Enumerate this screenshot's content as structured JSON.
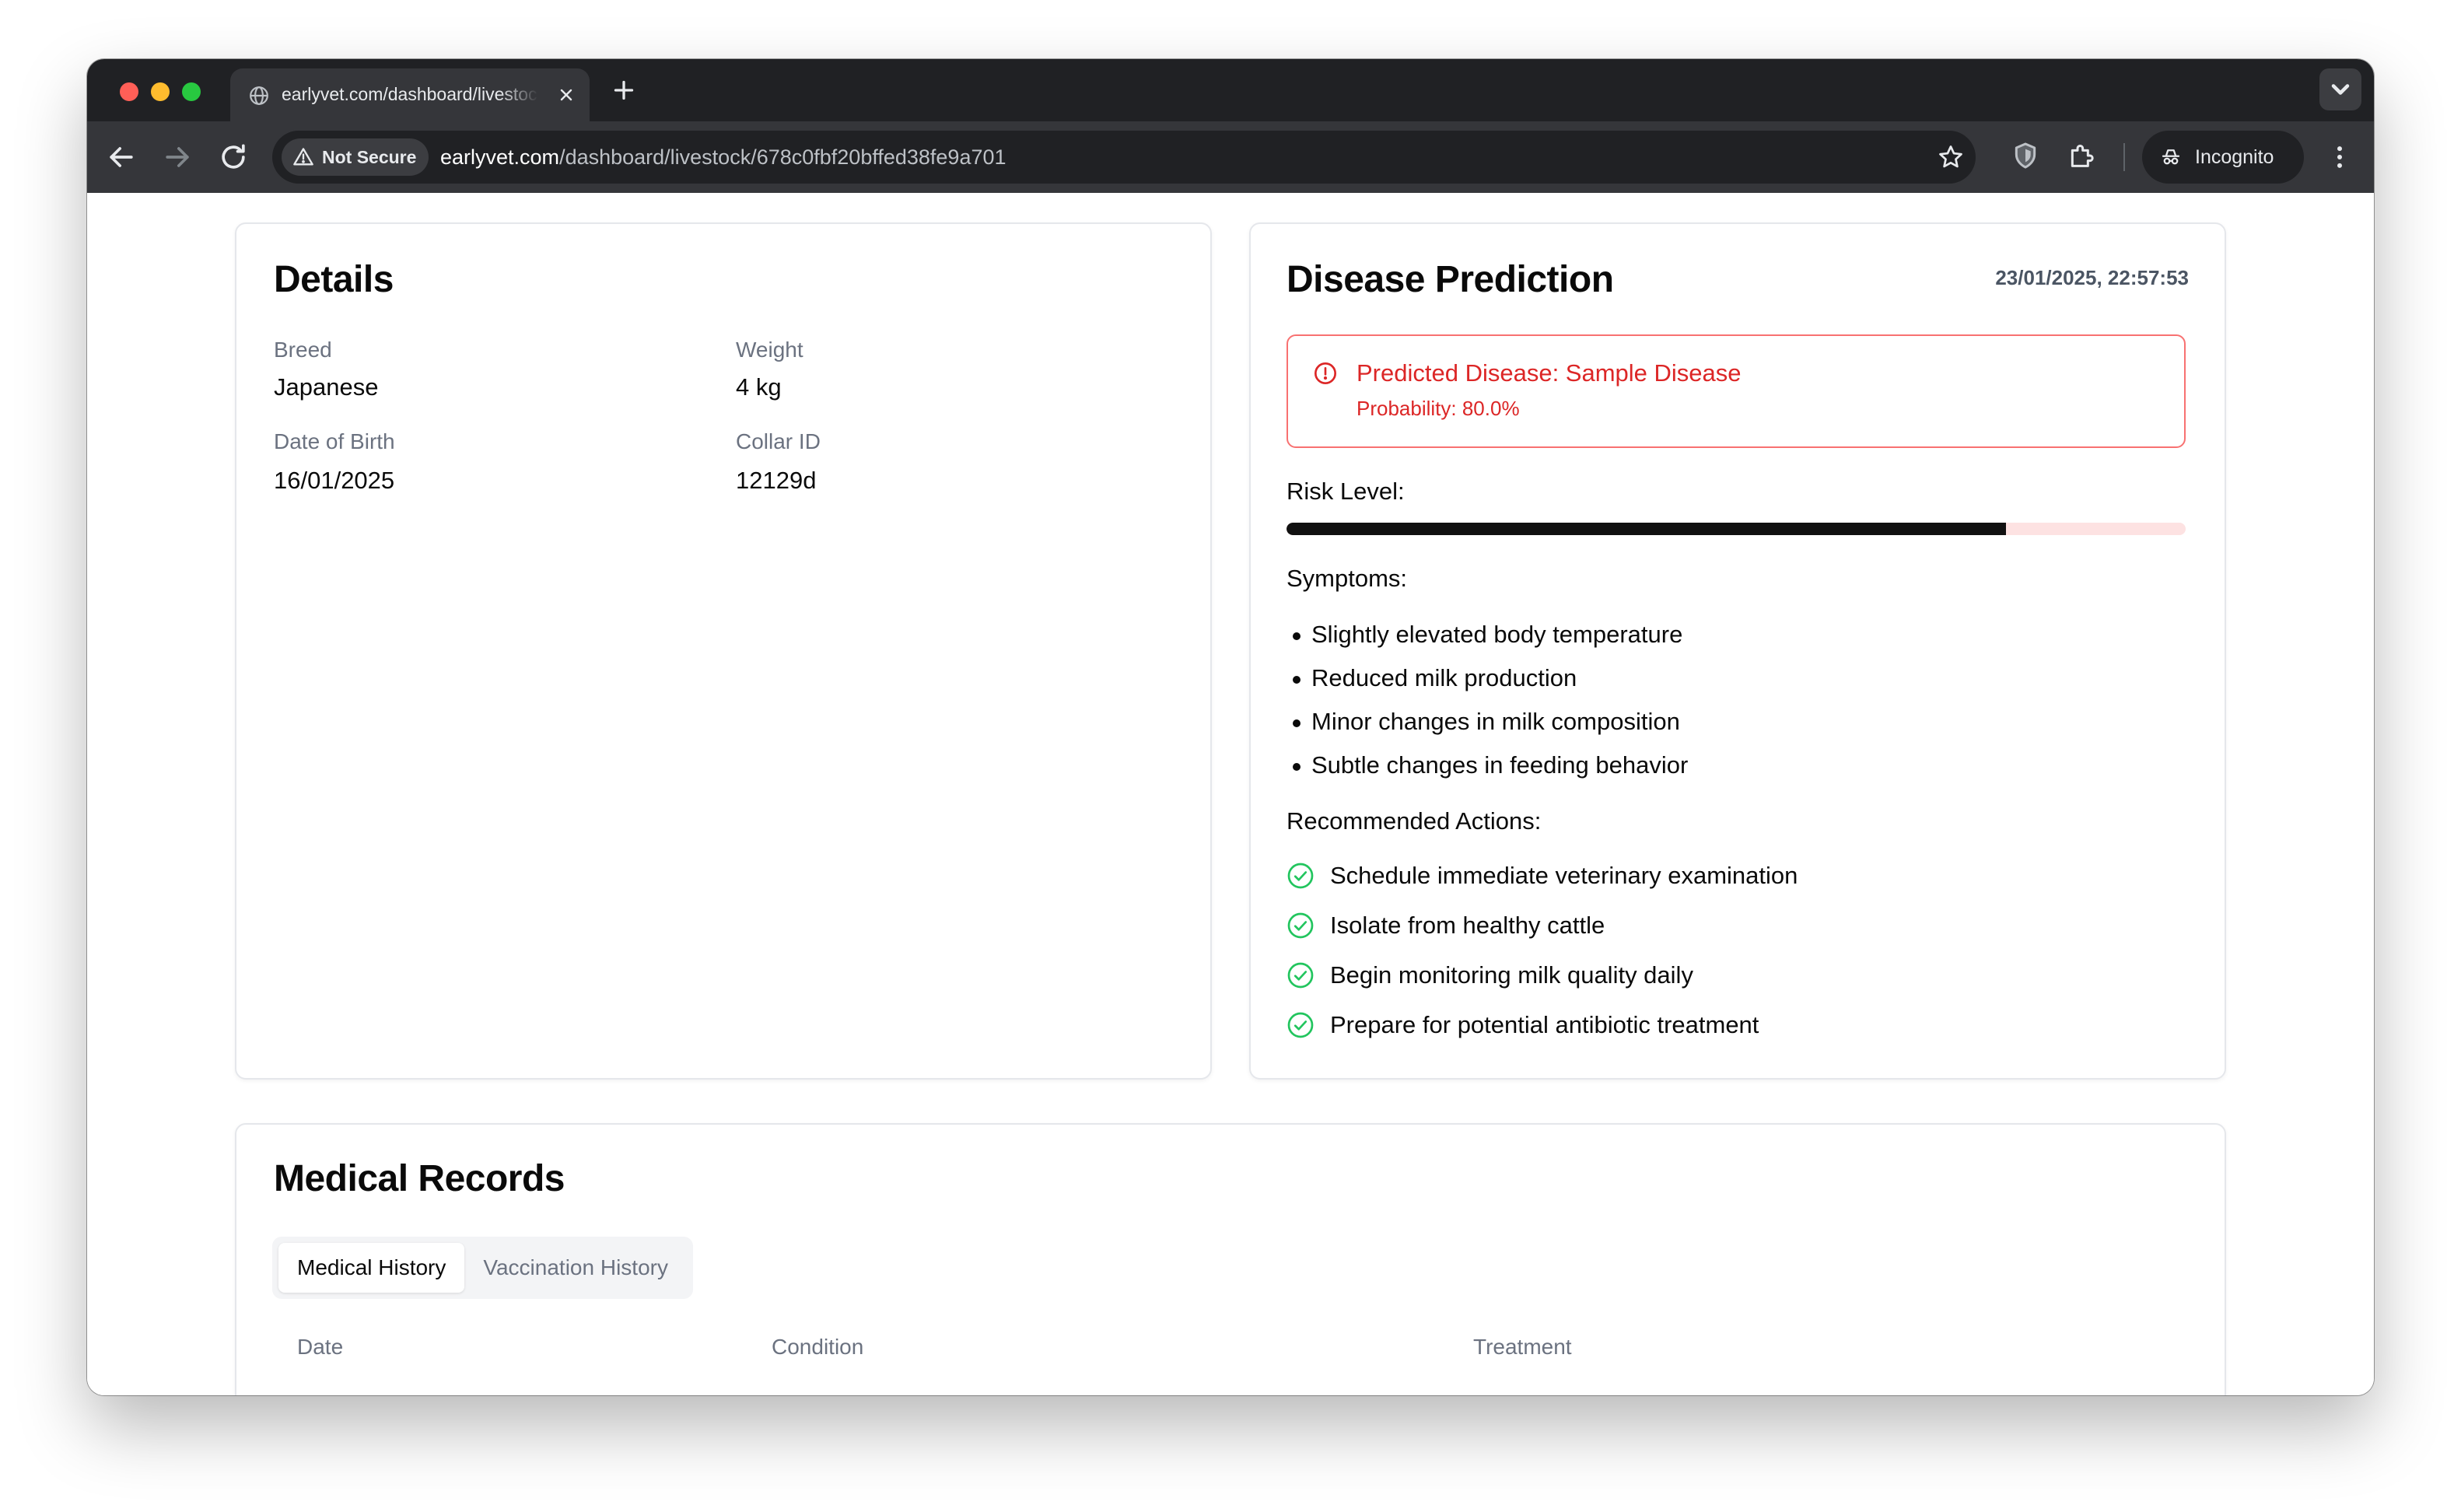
{
  "browser": {
    "tab_title": "earlyvet.com/dashboard/livestock/678c0fbf20bffed38fe9a701",
    "security_label": "Not Secure",
    "url_host": "earlyvet.com",
    "url_path": "/dashboard/livestock/678c0fbf20bffed38fe9a701",
    "incognito_label": "Incognito",
    "icons": [
      "globe-icon",
      "close-icon",
      "plus-icon",
      "chevron-down-icon",
      "back-icon",
      "forward-icon",
      "reload-icon",
      "warning-icon",
      "star-icon",
      "shield-icon",
      "puzzle-icon",
      "incognito-icon",
      "kebab-menu-icon"
    ]
  },
  "details": {
    "title": "Details",
    "breed_label": "Breed",
    "breed_value": "Japanese",
    "weight_label": "Weight",
    "weight_value": "4 kg",
    "dob_label": "Date of Birth",
    "dob_value": "16/01/2025",
    "collar_label": "Collar ID",
    "collar_value": "12129d"
  },
  "prediction": {
    "title": "Disease Prediction",
    "timestamp": "23/01/2025, 22:57:53",
    "alert_title": "Predicted Disease: Sample Disease",
    "alert_probability": "Probability: 80.0%",
    "risk_label": "Risk Level:",
    "risk_level": 0.8,
    "symptoms_label": "Symptoms:",
    "symptoms": [
      "Slightly elevated body temperature",
      "Reduced milk production",
      "Minor changes in milk composition",
      "Subtle changes in feeding behavior"
    ],
    "actions_label": "Recommended Actions:",
    "actions": [
      "Schedule immediate veterinary examination",
      "Isolate from healthy cattle",
      "Begin monitoring milk quality daily",
      "Prepare for potential antibiotic treatment"
    ]
  },
  "records": {
    "title": "Medical Records",
    "tabs": [
      {
        "label": "Medical History",
        "active": true
      },
      {
        "label": "Vaccination History",
        "active": false
      }
    ],
    "columns": [
      "Date",
      "Condition",
      "Treatment"
    ]
  },
  "colors": {
    "alert_red": "#dc2626",
    "check_green": "#22c55e",
    "risk_fill": "#111111",
    "risk_track": "#fde2e2"
  }
}
